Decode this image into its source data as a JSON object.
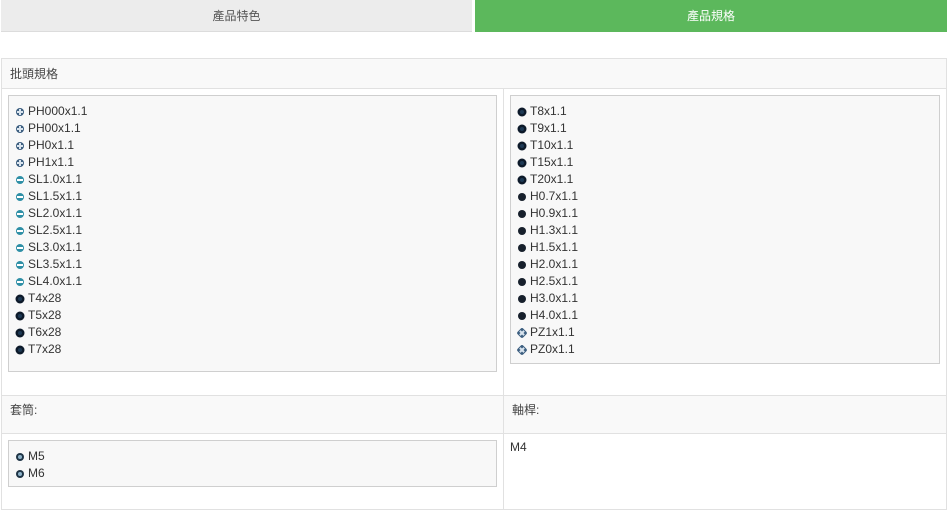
{
  "tabs": [
    {
      "label": "產品特色",
      "active": false
    },
    {
      "label": "產品規格",
      "active": true
    }
  ],
  "colors": {
    "active_tab": "#5cb85c",
    "inactive_tab": "#ececec"
  },
  "spec": {
    "bit_header": "批頭規格",
    "bits_left": [
      {
        "icon": "phillips-bit-icon",
        "label": "PH000x1.1"
      },
      {
        "icon": "phillips-bit-icon",
        "label": "PH00x1.1"
      },
      {
        "icon": "phillips-bit-icon",
        "label": "PH0x1.1"
      },
      {
        "icon": "phillips-bit-icon",
        "label": "PH1x1.1"
      },
      {
        "icon": "slotted-bit-icon",
        "label": "SL1.0x1.1"
      },
      {
        "icon": "slotted-bit-icon",
        "label": "SL1.5x1.1"
      },
      {
        "icon": "slotted-bit-icon",
        "label": "SL2.0x1.1"
      },
      {
        "icon": "slotted-bit-icon",
        "label": "SL2.5x1.1"
      },
      {
        "icon": "slotted-bit-icon",
        "label": "SL3.0x1.1"
      },
      {
        "icon": "slotted-bit-icon",
        "label": "SL3.5x1.1"
      },
      {
        "icon": "slotted-bit-icon",
        "label": "SL4.0x1.1"
      },
      {
        "icon": "torx-bit-icon",
        "label": "T4x28"
      },
      {
        "icon": "torx-bit-icon",
        "label": "T5x28"
      },
      {
        "icon": "torx-bit-icon",
        "label": "T6x28"
      },
      {
        "icon": "torx-bit-icon",
        "label": "T7x28"
      }
    ],
    "bits_right": [
      {
        "icon": "torx-bit-icon",
        "label": "T8x1.1"
      },
      {
        "icon": "torx-bit-icon",
        "label": "T9x1.1"
      },
      {
        "icon": "torx-bit-icon",
        "label": "T10x1.1"
      },
      {
        "icon": "torx-bit-icon",
        "label": "T15x1.1"
      },
      {
        "icon": "torx-bit-icon",
        "label": "T20x1.1"
      },
      {
        "icon": "hex-bit-icon",
        "label": "H0.7x1.1"
      },
      {
        "icon": "hex-bit-icon",
        "label": "H0.9x1.1"
      },
      {
        "icon": "hex-bit-icon",
        "label": "H1.3x1.1"
      },
      {
        "icon": "hex-bit-icon",
        "label": "H1.5x1.1"
      },
      {
        "icon": "hex-bit-icon",
        "label": "H2.0x1.1"
      },
      {
        "icon": "hex-bit-icon",
        "label": "H2.5x1.1"
      },
      {
        "icon": "hex-bit-icon",
        "label": "H3.0x1.1"
      },
      {
        "icon": "hex-bit-icon",
        "label": "H4.0x1.1"
      },
      {
        "icon": "pozidriv-bit-icon",
        "label": "PZ1x1.1"
      },
      {
        "icon": "pozidriv-bit-icon",
        "label": "PZ0x1.1"
      }
    ],
    "socket_header": "套筒:",
    "sockets": [
      {
        "icon": "socket-icon",
        "label": "M5"
      },
      {
        "icon": "socket-icon",
        "label": "M6"
      }
    ],
    "shaft_header": "軸桿:",
    "shaft_value": "M4"
  }
}
